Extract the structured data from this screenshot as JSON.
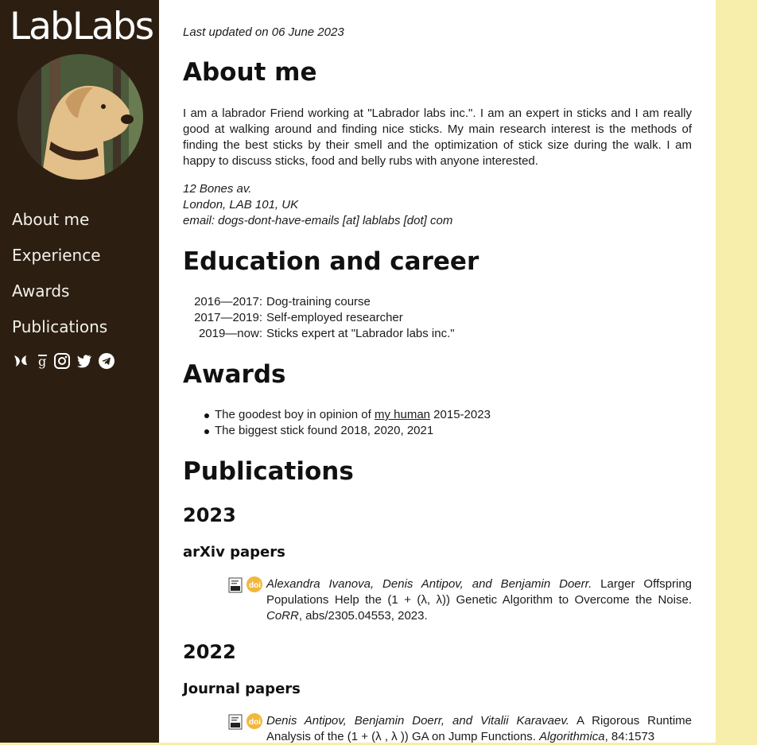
{
  "sidebar": {
    "brand": "LabLabs",
    "nav": [
      {
        "label": "About me"
      },
      {
        "label": "Experience"
      },
      {
        "label": "Awards"
      },
      {
        "label": "Publications"
      }
    ],
    "social_icons": [
      "orcid-butterfly-icon",
      "google-scholar-icon",
      "instagram-icon",
      "twitter-icon",
      "telegram-icon"
    ]
  },
  "main": {
    "last_updated": "Last updated on 06 June 2023",
    "about": {
      "title": "About me",
      "bio": "I am a labrador Friend working at \"Labrador labs inc.\". I am an expert in sticks and I am really good at walking around and finding nice sticks. My main research interest is the methods of finding the best sticks by their smell and the optimization of stick size during the walk. I am happy to discuss sticks, food and belly rubs with anyone interested.",
      "address": [
        "12 Bones av.",
        "London, LAB 101, UK",
        "email: dogs-dont-have-emails [at] lablabs [dot] com"
      ]
    },
    "education": {
      "title": "Education and career",
      "rows": [
        {
          "years": "2016—2017:",
          "desc": "Dog-training course"
        },
        {
          "years": "2017—2019:",
          "desc": "Self-employed researcher"
        },
        {
          "years": "2019—now:",
          "desc": "Sticks expert at \"Labrador labs inc.\""
        }
      ]
    },
    "awards": {
      "title": "Awards",
      "item1_before": "The goodest boy in opinion of ",
      "item1_link": "my human",
      "item1_after": " 2015-2023",
      "item2": "The biggest stick found 2018, 2020, 2021"
    },
    "publications": {
      "title": "Publications",
      "years": [
        {
          "year": "2023",
          "category": "arXiv papers",
          "paper": {
            "authors": "Alexandra Ivanova, Denis Antipov, and Benjamin Doerr.",
            "title": " Larger Offspring Populations Help the (1 + (λ, λ)) Genetic Algorithm to Overcome the Noise. ",
            "venue": "CoRR",
            "rest": ", abs/2305.04553, 2023."
          }
        },
        {
          "year": "2022",
          "category": "Journal papers",
          "paper": {
            "authors": "Denis Antipov, Benjamin Doerr, and Vitalii Karavaev.",
            "title": " A Rigorous Runtime Analysis of the (1 + (λ , λ )) GA on Jump Functions. ",
            "venue": "Algorithmica",
            "rest": ", 84:1573"
          }
        }
      ]
    }
  },
  "colors": {
    "sidebar_bg": "#2c1f12",
    "main_bg": "#ffffff",
    "right_bg": "#f7eeab",
    "doi_badge": "#f2b73c"
  }
}
